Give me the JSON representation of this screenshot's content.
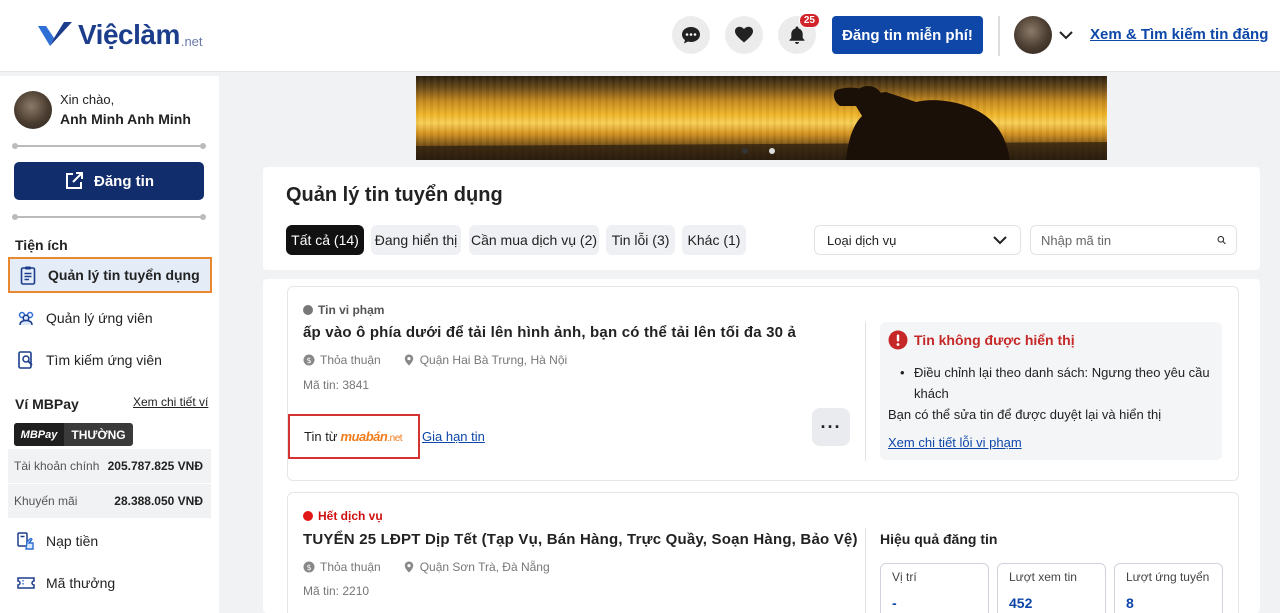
{
  "header": {
    "logo_main": "Việclàm",
    "logo_suffix": ".net",
    "notification_count": "25",
    "post_button": "Đăng tin miễn phí!",
    "search_link": "Xem & Tìm kiếm tin đăng"
  },
  "sidebar": {
    "greeting": "Xin chào,",
    "user_name": "Anh Minh Anh Minh",
    "post_button": "Đăng tin",
    "utilities_title": "Tiện ích",
    "items": [
      {
        "label": "Quản lý tin tuyển dụng",
        "icon": "clipboard-icon",
        "active": true
      },
      {
        "label": "Quản lý ứng viên",
        "icon": "users-icon"
      },
      {
        "label": "Tìm kiếm ứng viên",
        "icon": "search-candidate-icon"
      }
    ],
    "wallet_title": "Ví MBPay",
    "wallet_link": "Xem chi tiết ví",
    "wallet_badge_left": "MBPay",
    "wallet_badge_right": "THƯỜNG",
    "balances": [
      {
        "label": "Tài khoản chính",
        "value": "205.787.825 VNĐ"
      },
      {
        "label": "Khuyến mãi",
        "value": "28.388.050 VNĐ"
      }
    ],
    "bottom_items": [
      {
        "label": "Nạp tiền",
        "icon": "topup-icon"
      },
      {
        "label": "Mã thưởng",
        "icon": "voucher-icon"
      }
    ]
  },
  "main": {
    "title": "Quản lý tin tuyển dụng",
    "tabs": [
      {
        "label": "Tất cả (14)",
        "active": true
      },
      {
        "label": "Đang hiển thị"
      },
      {
        "label": "Cần mua dịch vụ (2)"
      },
      {
        "label": "Tin lỗi (3)"
      },
      {
        "label": "Khác (1)"
      }
    ],
    "service_select": "Loại dịch vụ",
    "search_placeholder": "Nhập mã tin"
  },
  "listings": [
    {
      "status": "Tin vi phạm",
      "status_color": "#777777",
      "title": "ấp vào ô phía dưới để tải lên hình ảnh, bạn có thể tải lên tối đa 30 ả",
      "salary": "Thỏa thuận",
      "location": "Quận Hai Bà Trưng, Hà Nội",
      "code": "Mã tin: 3841",
      "source_prefix": "Tin từ",
      "source_brand": "muabán",
      "source_suffix": ".net",
      "renew_link": "Gia hạn tin",
      "more_label": "···",
      "alert": {
        "title": "Tin không được hiển thị",
        "bullet": "Điều chỉnh lại theo danh sách: Ngưng theo yêu cầu khách",
        "note": "Bạn có thể sửa tin để được duyệt lại và hiển thị",
        "link": "Xem chi tiết lỗi vi phạm"
      }
    },
    {
      "status": "Hết dịch vụ",
      "status_color": "#d01010",
      "title": "TUYỂN 25 LĐPT Dịp Tết (Tạp Vụ, Bán Hàng, Trực Quầy, Soạn Hàng, Bảo Vệ)",
      "salary": "Thỏa thuận",
      "location": "Quận Sơn Trà, Đà Nẵng",
      "code": "Mã tin: 2210",
      "performance_title": "Hiệu quả đăng tin",
      "stats": [
        {
          "label": "Vị trí",
          "value": "-"
        },
        {
          "label": "Lượt xem tin",
          "value": "452"
        },
        {
          "label": "Lượt ứng tuyển",
          "value": "8"
        }
      ]
    }
  ],
  "colors": {
    "brand": "#0e47a8",
    "sidebar_button": "#112d6b",
    "danger": "#c62828",
    "highlight": "#e9882f"
  }
}
